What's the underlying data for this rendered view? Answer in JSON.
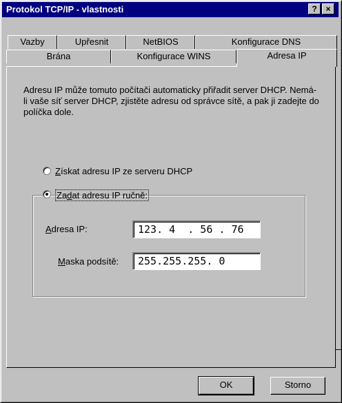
{
  "window": {
    "title": "Protokol TCP/IP - vlastnosti",
    "help_label": "?",
    "close_label": "×"
  },
  "tabs": {
    "row1": [
      "Vazby",
      "Upřesnit",
      "NetBIOS",
      "Konfigurace DNS"
    ],
    "row2": [
      "Brána",
      "Konfigurace WINS",
      "Adresa IP"
    ],
    "active": "Adresa IP"
  },
  "panel": {
    "description": "Adresu IP může tomuto počítači automaticky přiřadit server DHCP. Nemá-li vaše síť server DHCP, zjistěte adresu od správce sítě, a pak ji zadejte do políčka dole.",
    "radio_dhcp": {
      "prefix": "Z",
      "rest": "ískat adresu IP ze serveru DHCP",
      "selected": false
    },
    "radio_manual": {
      "prefix": "Za",
      "accel": "d",
      "rest": "at adresu IP ručně:",
      "selected": true
    },
    "ip_label": {
      "accel": "A",
      "rest": "dresa IP:"
    },
    "ip_value": "123. 4  . 56 . 76",
    "mask_label": {
      "accel": "M",
      "rest": "aska podsítě:"
    },
    "mask_value": "255.255.255. 0"
  },
  "buttons": {
    "ok": "OK",
    "cancel": "Storno"
  }
}
